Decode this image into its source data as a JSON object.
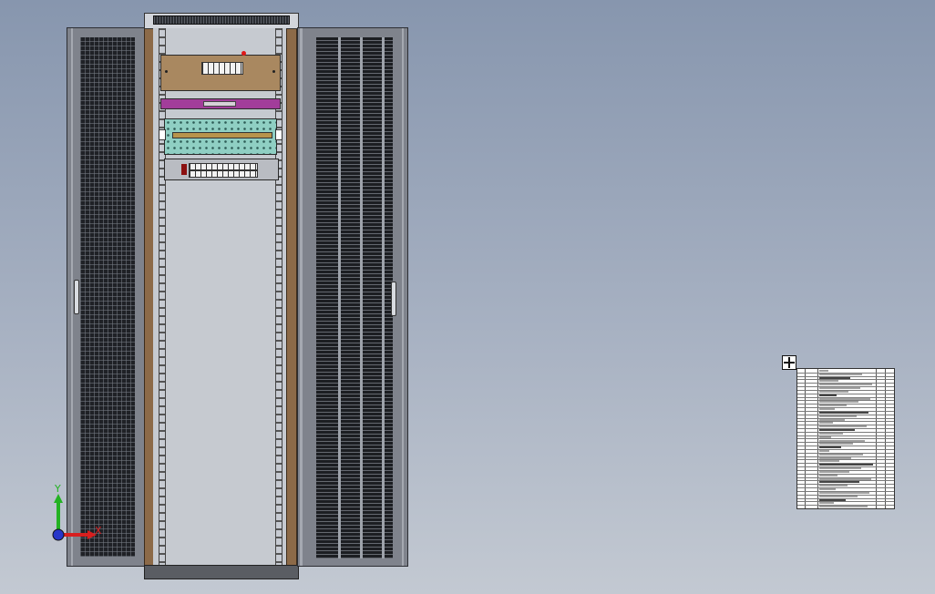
{
  "window": {
    "title": ""
  },
  "triad": {
    "x_label": "X",
    "y_label": "Y",
    "x_color": "#d81f1f",
    "y_color": "#23b223",
    "z_color": "#2636c9"
  },
  "colors": {
    "background_top": "#8796ae",
    "background_bottom": "#c3c9d2",
    "frame_wood": "#8c6a48",
    "mesh": "#1f2126"
  },
  "icons": {
    "move_handle": "move-arrows-icon",
    "alarm_marker": "red-pin-icon"
  },
  "bom_table": {
    "rows": 40
  }
}
